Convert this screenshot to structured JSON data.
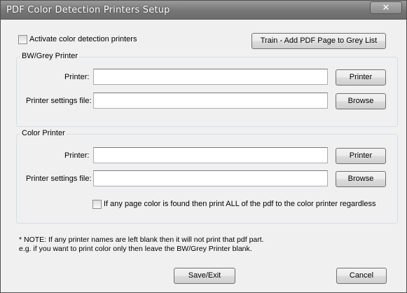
{
  "window": {
    "title": "PDF Color Detection Printers Setup",
    "close_glyph": "✕"
  },
  "activate": {
    "label": "Activate color detection printers",
    "checked": false
  },
  "train_button": "Train - Add PDF Page to Grey List",
  "bw_group": {
    "title": "BW/Grey Printer",
    "printer_label": "Printer:",
    "printer_value": "",
    "printer_button": "Printer",
    "settings_label": "Printer settings file:",
    "settings_value": "",
    "browse_button": "Browse"
  },
  "color_group": {
    "title": "Color Printer",
    "printer_label": "Printer:",
    "printer_value": "",
    "printer_button": "Printer",
    "settings_label": "Printer settings file:",
    "settings_value": "",
    "browse_button": "Browse",
    "print_all_label": "If any page color is found then print ALL of the pdf to the color printer regardless",
    "print_all_checked": false
  },
  "note": {
    "line1": "* NOTE: If any printer names are left blank then it will not print that pdf part.",
    "line2": "e.g. if you want to print color only then leave the BW/Grey Printer blank."
  },
  "save_button": "Save/Exit",
  "cancel_button": "Cancel"
}
